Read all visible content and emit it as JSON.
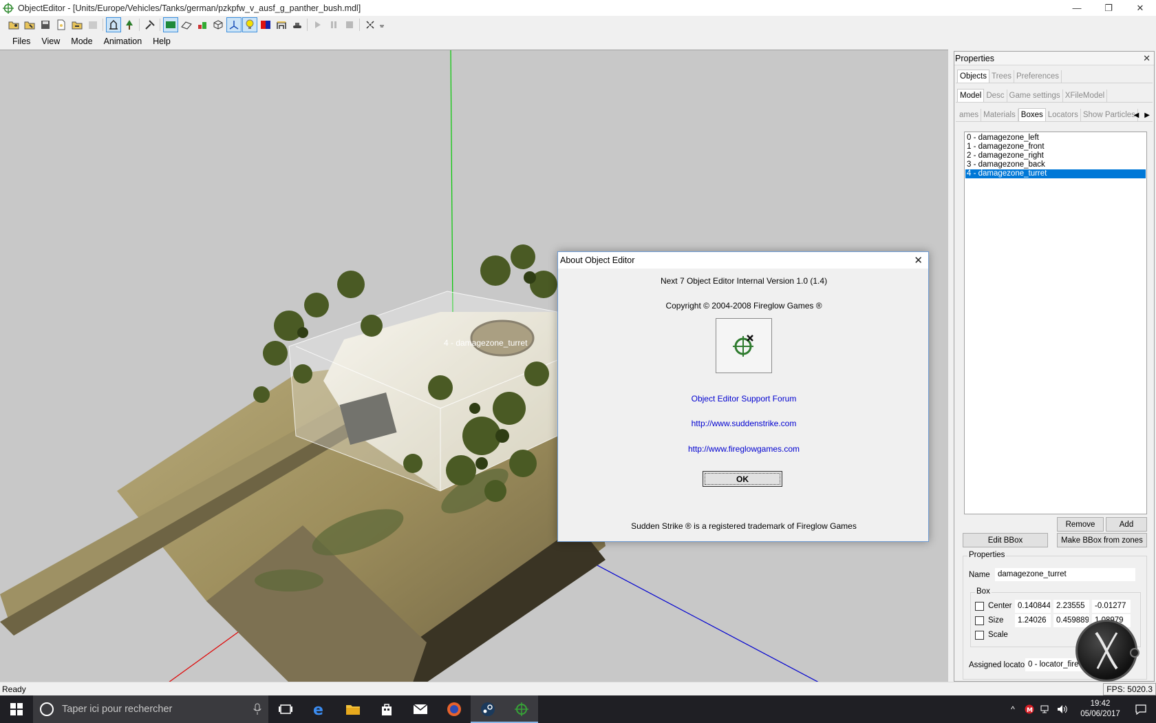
{
  "window": {
    "title": "ObjectEditor - [Units/Europe/Vehicles/Tanks/german/pzkpfw_v_ausf_g_panther_bush.mdl]",
    "minimize_glyph": "—",
    "restore_glyph": "❐",
    "close_glyph": "✕"
  },
  "menu": {
    "items": [
      "Files",
      "View",
      "Mode",
      "Animation",
      "Help"
    ]
  },
  "viewport": {
    "box_label": "4 - damagezone_turret",
    "background_color": "#c8c8c8"
  },
  "statusbar": {
    "text": "Ready",
    "fps": "FPS: 5020.3"
  },
  "properties": {
    "title": "Properties",
    "close_glyph": "✕",
    "tabs_top": [
      "Objects",
      "Trees",
      "Preferences"
    ],
    "tabs_mid": [
      "Model",
      "Desc",
      "Game settings",
      "XFileModel"
    ],
    "tabs_sub": [
      "ames",
      "Materials",
      "Boxes",
      "Locators",
      "Show Particles"
    ],
    "arrow_left": "◀",
    "arrow_right": "▶",
    "boxes": [
      "0 - damagezone_left",
      "1 - damagezone_front",
      "2 - damagezone_right",
      "3 - damagezone_back",
      "4 - damagezone_turret"
    ],
    "remove_label": "Remove",
    "add_label": "Add",
    "edit_bbox_label": "Edit BBox",
    "make_bbox_label": "Make BBox from zones",
    "group_title": "Properties",
    "name_label": "Name",
    "name_value": "damagezone_turret",
    "box_group_title": "Box",
    "center_label": "Center",
    "center_values": [
      "0.140844",
      "2.23555",
      "-0.01277"
    ],
    "size_label": "Size",
    "size_values": [
      "1.24026",
      "0.459889",
      "1.08979"
    ],
    "scale_label": "Scale",
    "locator_label": "Assigned locator",
    "locator_value": "0 - locator_fire"
  },
  "about": {
    "title": "About Object Editor",
    "close_glyph": "✕",
    "version": "Next 7 Object Editor Internal Version 1.0 (1.4)",
    "copyright": "Copyright © 2004-2008 Fireglow Games ®",
    "forum_link": "Object Editor Support Forum",
    "link1": "http://www.suddenstrike.com",
    "link2": "http://www.fireglowgames.com",
    "ok_label": "OK",
    "trademark": "Sudden Strike ® is a registered trademark of Fireglow Games"
  },
  "taskbar": {
    "search_placeholder": "Taper ici pour rechercher",
    "time": "19:42",
    "date": "05/06/2017",
    "tray_arrow": "^"
  },
  "colors": {
    "selection": "#0078d7",
    "link": "#0000d0",
    "axis_x": "#e00000",
    "axis_y": "#00c800",
    "axis_z": "#0000d0",
    "taskbar": "#1f1f24"
  }
}
